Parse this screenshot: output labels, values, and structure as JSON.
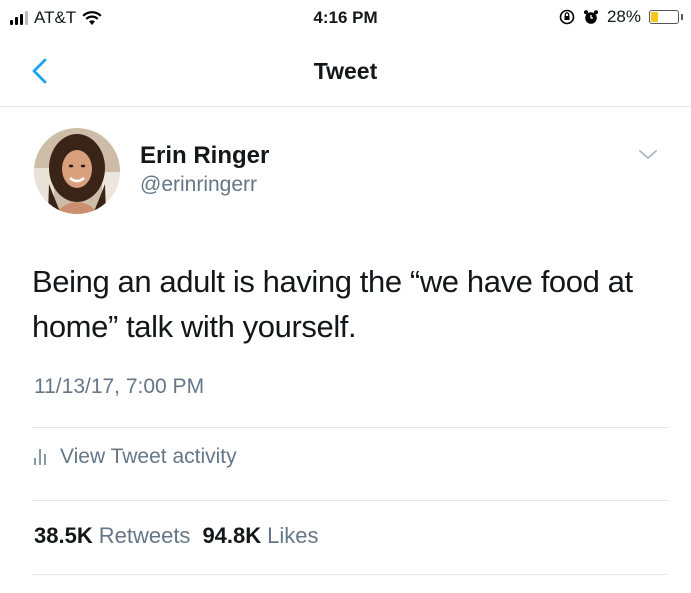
{
  "status_bar": {
    "carrier": "AT&T",
    "time": "4:16 PM",
    "battery_percent": "28%",
    "battery_level": 0.28,
    "icons": [
      "signal-icon",
      "wifi-icon",
      "orientation-lock-icon",
      "alarm-icon",
      "battery-icon"
    ],
    "battery_color": "#f5c518"
  },
  "nav": {
    "title": "Tweet",
    "back_icon": "chevron-left-icon",
    "accent_color": "#1da1f2"
  },
  "tweet": {
    "author_name": "Erin Ringer",
    "author_handle": "@erinringerr",
    "text": "Being an adult is having the “we have food at home” talk with yourself.",
    "timestamp": "11/13/17, 7:00 PM"
  },
  "activity": {
    "label": "View Tweet activity",
    "icon": "activity-bars-icon"
  },
  "stats": {
    "retweets_count": "38.5K",
    "retweets_label": "Retweets",
    "likes_count": "94.8K",
    "likes_label": "Likes"
  }
}
